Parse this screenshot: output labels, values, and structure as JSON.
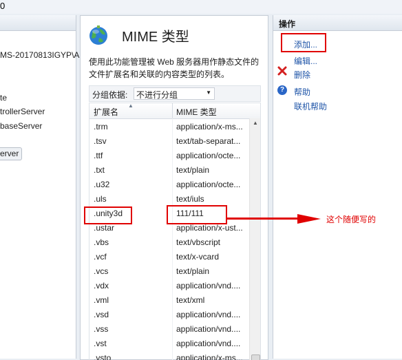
{
  "top_glyph": "0",
  "tree": {
    "items": [
      "MS-20170813IGYP\\A",
      "te",
      "trollerServer",
      "baseServer"
    ],
    "button_label": "erver"
  },
  "main": {
    "title": "MIME 类型",
    "description": "使用此功能管理被 Web 服务器用作静态文件的文件扩展名和关联的内容类型的列表。",
    "group_by_label": "分组依据:",
    "group_by_value": "不进行分组",
    "columns": [
      "扩展名",
      "MIME 类型"
    ],
    "rows": [
      {
        "ext": ".trm",
        "type": "application/x-ms..."
      },
      {
        "ext": ".tsv",
        "type": "text/tab-separat..."
      },
      {
        "ext": ".ttf",
        "type": "application/octe..."
      },
      {
        "ext": ".txt",
        "type": "text/plain"
      },
      {
        "ext": ".u32",
        "type": "application/octe..."
      },
      {
        "ext": ".uls",
        "type": "text/iuls"
      },
      {
        "ext": ".unity3d",
        "type": "111/111"
      },
      {
        "ext": ".ustar",
        "type": "application/x-ust..."
      },
      {
        "ext": ".vbs",
        "type": "text/vbscript"
      },
      {
        "ext": ".vcf",
        "type": "text/x-vcard"
      },
      {
        "ext": ".vcs",
        "type": "text/plain"
      },
      {
        "ext": ".vdx",
        "type": "application/vnd...."
      },
      {
        "ext": ".vml",
        "type": "text/xml"
      },
      {
        "ext": ".vsd",
        "type": "application/vnd...."
      },
      {
        "ext": ".vss",
        "type": "application/vnd...."
      },
      {
        "ext": ".vst",
        "type": "application/vnd...."
      },
      {
        "ext": ".vsto",
        "type": "application/x-ms..."
      }
    ]
  },
  "actions": {
    "title": "操作",
    "add": "添加...",
    "edit": "编辑...",
    "delete": "删除",
    "help": "帮助",
    "online_help": "联机帮助"
  },
  "annotation": {
    "text": "这个随便写的",
    "color": "#e00000"
  },
  "colors": {
    "link": "#1f55a8",
    "panel_border": "#c5ccd6"
  },
  "icons": [
    "globe-icon",
    "delete-x-icon",
    "help-icon",
    "sort-caret-icon",
    "dropdown-arrow-icon"
  ]
}
